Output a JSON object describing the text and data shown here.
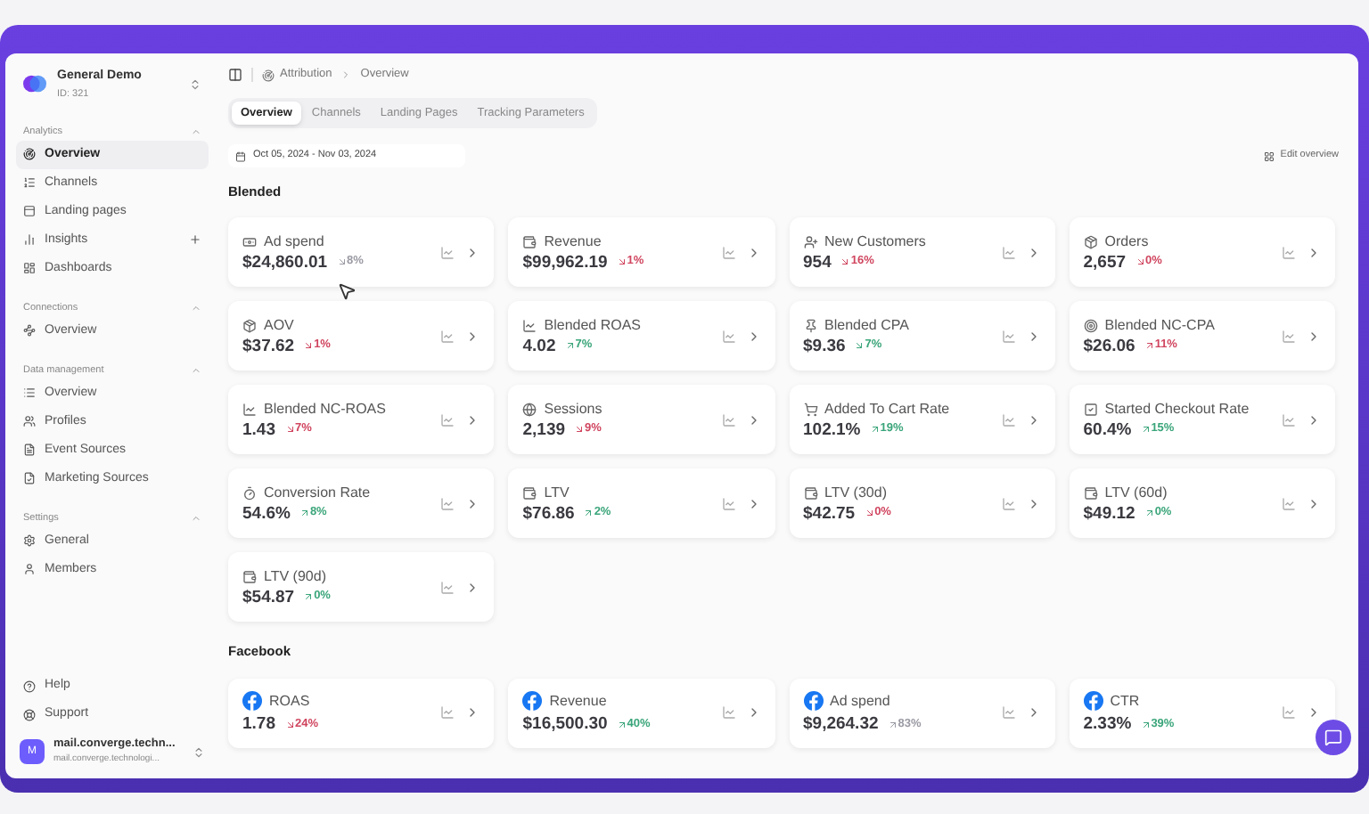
{
  "workspace": {
    "name": "General Demo",
    "id": "ID: 321"
  },
  "sidebar": {
    "sections": [
      {
        "title": "Analytics",
        "expanded": true,
        "items": [
          {
            "label": "Overview",
            "selected": true,
            "kind": "link"
          },
          {
            "label": "Channels",
            "selected": false,
            "kind": "link"
          },
          {
            "label": "Landing pages",
            "selected": false,
            "kind": "link"
          },
          {
            "label": "Insights",
            "selected": false,
            "kind": "add"
          },
          {
            "label": "Dashboards",
            "selected": false,
            "kind": "link"
          }
        ]
      },
      {
        "title": "Connections",
        "expanded": true,
        "items": [
          {
            "label": "Overview",
            "selected": false,
            "kind": "link"
          }
        ]
      },
      {
        "title": "Data management",
        "expanded": true,
        "items": [
          {
            "label": "Overview",
            "selected": false,
            "kind": "link"
          },
          {
            "label": "Profiles",
            "selected": false,
            "kind": "link"
          },
          {
            "label": "Event Sources",
            "selected": false,
            "kind": "link"
          },
          {
            "label": "Marketing Sources",
            "selected": false,
            "kind": "link"
          }
        ]
      },
      {
        "title": "Settings",
        "expanded": true,
        "items": [
          {
            "label": "General",
            "selected": false,
            "kind": "link"
          },
          {
            "label": "Members",
            "selected": false,
            "kind": "link"
          }
        ]
      }
    ],
    "footer_links": [
      "Help",
      "Support"
    ],
    "user": {
      "avatar": "M",
      "name": "mail.converge.techn...",
      "email": "mail.converge.technologi..."
    }
  },
  "breadcrumb": [
    "Attribution",
    "Overview"
  ],
  "tabs": [
    {
      "label": "Overview",
      "selected": true
    },
    {
      "label": "Channels",
      "selected": false
    },
    {
      "label": "Landing Pages",
      "selected": false
    },
    {
      "label": "Tracking Parameters",
      "selected": false
    }
  ],
  "date_range": "Oct 05, 2024 - Nov 03, 2024",
  "edit_overview": "Edit overview",
  "sections": [
    {
      "title": "Blended",
      "kind": "blended",
      "cards": [
        {
          "label": "Ad spend",
          "value": "$24,860.01",
          "change": "8%",
          "trend_up": false,
          "color": "#9a9aa4"
        },
        {
          "label": "Revenue",
          "value": "$99,962.19",
          "change": "1%",
          "trend_up": false,
          "color": "#d0455f"
        },
        {
          "label": "New Customers",
          "value": "954",
          "change": "16%",
          "trend_up": false,
          "color": "#d0455f"
        },
        {
          "label": "Orders",
          "value": "2,657",
          "change": "0%",
          "trend_up": false,
          "color": "#d0455f"
        },
        {
          "label": "AOV",
          "value": "$37.62",
          "change": "1%",
          "trend_up": false,
          "color": "#d0455f"
        },
        {
          "label": "Blended ROAS",
          "value": "4.02",
          "change": "7%",
          "trend_up": true,
          "color": "#3aa57a"
        },
        {
          "label": "Blended CPA",
          "value": "$9.36",
          "change": "7%",
          "trend_up": false,
          "color": "#3aa57a"
        },
        {
          "label": "Blended NC-CPA",
          "value": "$26.06",
          "change": "11%",
          "trend_up": true,
          "color": "#d0455f"
        },
        {
          "label": "Blended NC-ROAS",
          "value": "1.43",
          "change": "7%",
          "trend_up": false,
          "color": "#d0455f"
        },
        {
          "label": "Sessions",
          "value": "2,139",
          "change": "9%",
          "trend_up": false,
          "color": "#d0455f"
        },
        {
          "label": "Added To Cart Rate",
          "value": "102.1%",
          "change": "19%",
          "trend_up": true,
          "color": "#3aa57a"
        },
        {
          "label": "Started Checkout Rate",
          "value": "60.4%",
          "change": "15%",
          "trend_up": true,
          "color": "#3aa57a"
        },
        {
          "label": "Conversion Rate",
          "value": "54.6%",
          "change": "8%",
          "trend_up": true,
          "color": "#3aa57a"
        },
        {
          "label": "LTV",
          "value": "$76.86",
          "change": "2%",
          "trend_up": true,
          "color": "#3aa57a"
        },
        {
          "label": "LTV (30d)",
          "value": "$42.75",
          "change": "0%",
          "trend_up": false,
          "color": "#d0455f"
        },
        {
          "label": "LTV (60d)",
          "value": "$49.12",
          "change": "0%",
          "trend_up": true,
          "color": "#3aa57a"
        },
        {
          "label": "LTV (90d)",
          "value": "$54.87",
          "change": "0%",
          "trend_up": true,
          "color": "#3aa57a"
        }
      ]
    },
    {
      "title": "Facebook",
      "kind": "facebook",
      "cards": [
        {
          "label": "ROAS",
          "value": "1.78",
          "change": "24%",
          "trend_up": false,
          "color": "#d0455f"
        },
        {
          "label": "Revenue",
          "value": "$16,500.30",
          "change": "40%",
          "trend_up": true,
          "color": "#3aa57a"
        },
        {
          "label": "Ad spend",
          "value": "$9,264.32",
          "change": "83%",
          "trend_up": true,
          "color": "#9a9aa4"
        },
        {
          "label": "CTR",
          "value": "2.33%",
          "change": "39%",
          "trend_up": true,
          "color": "#3aa57a"
        }
      ]
    }
  ]
}
